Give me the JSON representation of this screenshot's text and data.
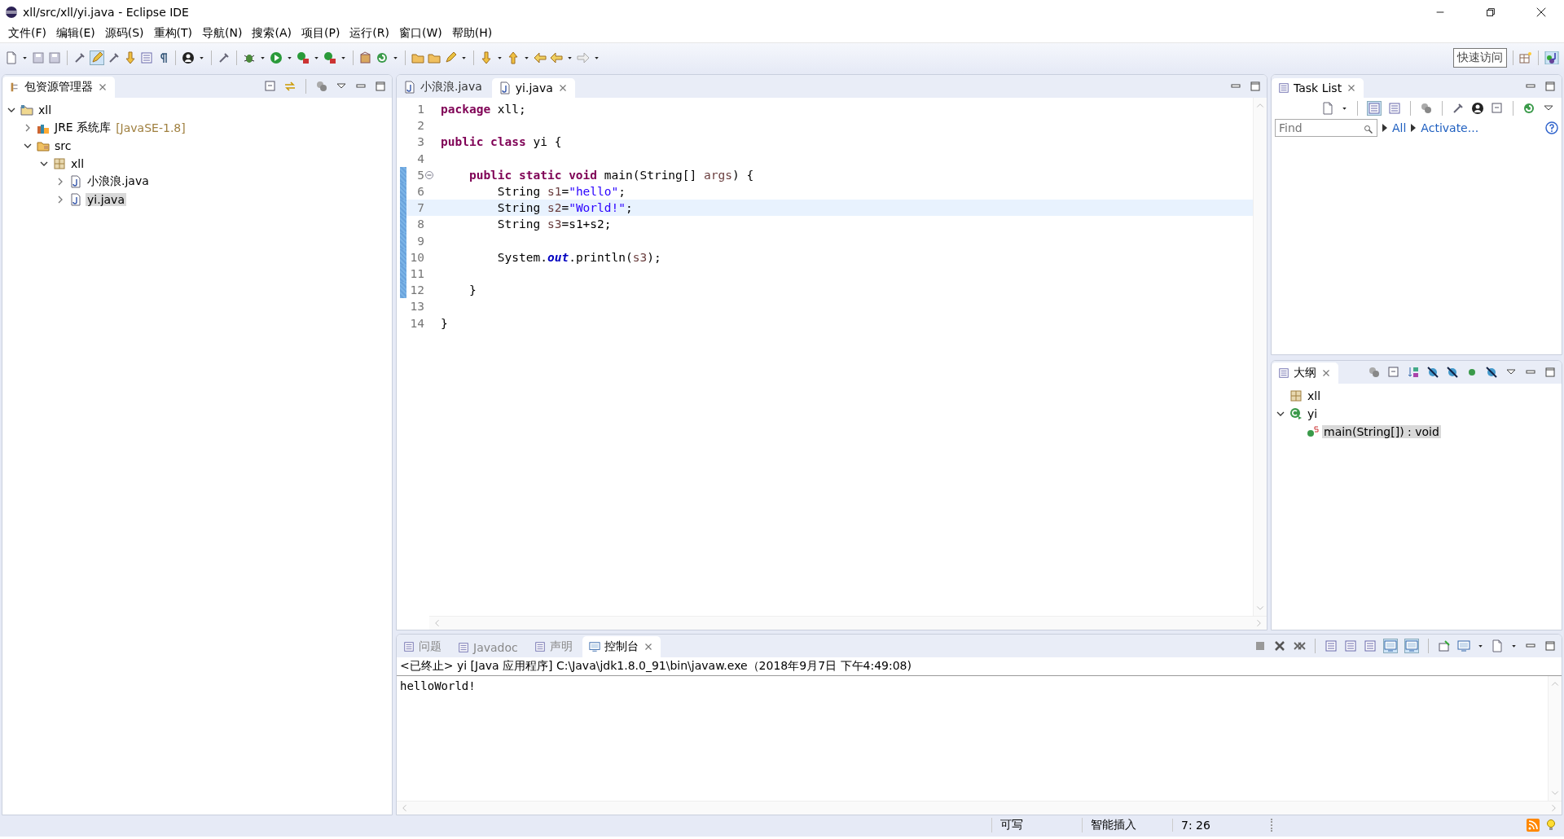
{
  "window": {
    "title": "xll/src/xll/yi.java - Eclipse IDE"
  },
  "menu": [
    "文件(F)",
    "编辑(E)",
    "源码(S)",
    "重构(T)",
    "导航(N)",
    "搜索(A)",
    "项目(P)",
    "运行(R)",
    "窗口(W)",
    "帮助(H)"
  ],
  "quick_access": "快速访问",
  "package_explorer": {
    "title": "包资源管理器",
    "tree": [
      {
        "label": "xll",
        "kind": "project",
        "expanded": true,
        "selected": false,
        "children": [
          {
            "label": "JRE 系统库",
            "note": "[JavaSE-1.8]",
            "kind": "library",
            "expanded": false,
            "selected": false
          },
          {
            "label": "src",
            "kind": "folder",
            "expanded": true,
            "selected": false,
            "children": [
              {
                "label": "xll",
                "kind": "package",
                "expanded": true,
                "selected": false,
                "children": [
                  {
                    "label": "小浪浪.java",
                    "kind": "file",
                    "expanded": false,
                    "selected": false
                  },
                  {
                    "label": "yi.java",
                    "kind": "file",
                    "expanded": false,
                    "selected": true
                  }
                ]
              }
            ]
          }
        ]
      }
    ]
  },
  "editor": {
    "tabs": [
      {
        "label": "小浪浪.java",
        "selected": false
      },
      {
        "label": "yi.java",
        "selected": true
      }
    ],
    "lines": [
      {
        "number": "1",
        "selected": false,
        "changed": false,
        "foldable": false,
        "tokens": [
          {
            "kind": "keyword",
            "text": "package"
          },
          {
            "kind": "plain",
            "text": " xll;"
          }
        ]
      },
      {
        "number": "2",
        "selected": false,
        "changed": false,
        "foldable": false
      },
      {
        "number": "3",
        "selected": false,
        "changed": false,
        "foldable": false,
        "tokens": [
          {
            "kind": "keyword",
            "text": "public class"
          },
          {
            "kind": "plain",
            "text": " yi {"
          }
        ]
      },
      {
        "number": "4",
        "selected": false,
        "changed": false,
        "foldable": false
      },
      {
        "number": "5",
        "selected": false,
        "changed": true,
        "foldable": true,
        "tokens": [
          {
            "kind": "keyword",
            "text": "    public static void"
          },
          {
            "kind": "plain",
            "text": " main(String[] "
          },
          {
            "kind": "variable",
            "text": "args"
          },
          {
            "kind": "plain",
            "text": ") {"
          }
        ]
      },
      {
        "number": "6",
        "selected": false,
        "changed": true,
        "foldable": false,
        "tokens": [
          {
            "kind": "plain",
            "text": "        String "
          },
          {
            "kind": "variable",
            "text": "s1"
          },
          {
            "kind": "plain",
            "text": "="
          },
          {
            "kind": "string",
            "text": "\"hello\""
          },
          {
            "kind": "plain",
            "text": ";"
          }
        ]
      },
      {
        "number": "7",
        "selected": true,
        "changed": true,
        "foldable": false,
        "tokens": [
          {
            "kind": "plain",
            "text": "        String "
          },
          {
            "kind": "variable",
            "text": "s2"
          },
          {
            "kind": "plain",
            "text": "="
          },
          {
            "kind": "string",
            "text": "\"World!\""
          },
          {
            "kind": "plain",
            "text": ";"
          }
        ]
      },
      {
        "number": "8",
        "selected": false,
        "changed": true,
        "foldable": false,
        "tokens": [
          {
            "kind": "plain",
            "text": "        String "
          },
          {
            "kind": "variable",
            "text": "s3"
          },
          {
            "kind": "plain",
            "text": "=s1+s2;"
          }
        ]
      },
      {
        "number": "9",
        "selected": false,
        "changed": true,
        "foldable": false
      },
      {
        "number": "10",
        "selected": false,
        "changed": true,
        "foldable": false,
        "tokens": [
          {
            "kind": "plain",
            "text": "        System."
          },
          {
            "kind": "field",
            "text": "out"
          },
          {
            "kind": "plain",
            "text": ".println("
          },
          {
            "kind": "variable",
            "text": "s3"
          },
          {
            "kind": "plain",
            "text": ");"
          }
        ]
      },
      {
        "number": "11",
        "selected": false,
        "changed": true,
        "foldable": false
      },
      {
        "number": "12",
        "selected": false,
        "changed": true,
        "foldable": false,
        "tokens": [
          {
            "kind": "plain",
            "text": "    }"
          }
        ]
      },
      {
        "number": "13",
        "selected": false,
        "changed": false,
        "foldable": false
      },
      {
        "number": "14",
        "selected": false,
        "changed": false,
        "foldable": false,
        "tokens": [
          {
            "kind": "plain",
            "text": "}"
          }
        ]
      }
    ]
  },
  "task_list": {
    "title": "Task List",
    "find": {
      "placeholder": "Find"
    },
    "links": [
      "All",
      "Activate..."
    ]
  },
  "outline": {
    "title": "大纲",
    "tree": [
      {
        "label": "xll",
        "kind": "package",
        "selected": false
      },
      {
        "label": "yi",
        "kind": "class",
        "expanded": true,
        "selected": false,
        "children": [
          {
            "label": "main(String[]) : void",
            "kind": "method",
            "selected": true
          }
        ]
      }
    ]
  },
  "console": {
    "tabs": [
      {
        "label": "问题",
        "selected": false
      },
      {
        "label": "Javadoc",
        "selected": false
      },
      {
        "label": "声明",
        "selected": false
      },
      {
        "label": "控制台",
        "selected": true
      }
    ],
    "header": "<已终止> yi [Java 应用程序] C:\\Java\\jdk1.8.0_91\\bin\\javaw.exe（2018年9月7日 下午4:49:08)",
    "output": "helloWorld!"
  },
  "status_bar": [
    "可写",
    "智能插入",
    "7: 26"
  ]
}
